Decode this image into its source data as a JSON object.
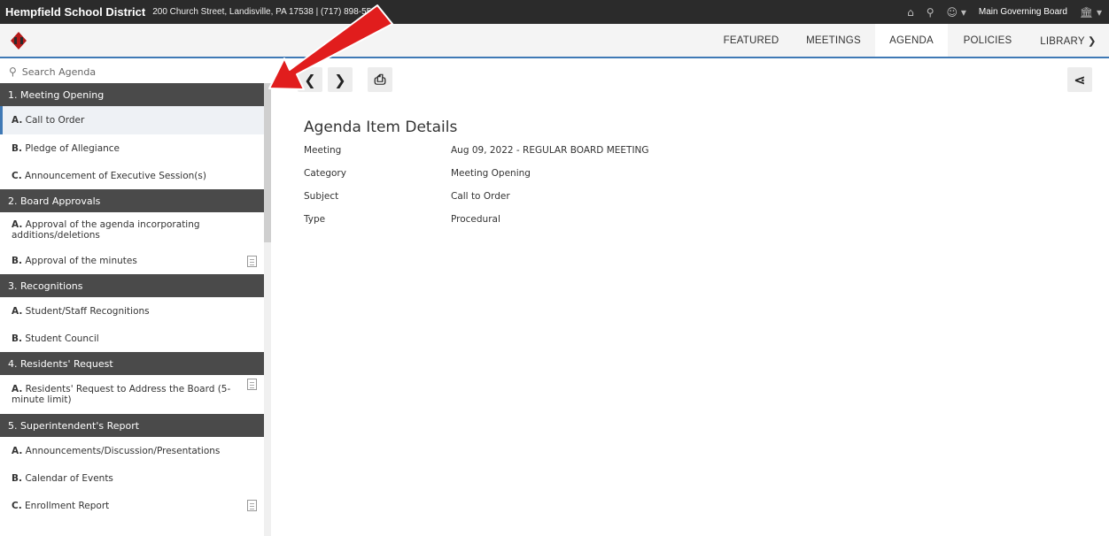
{
  "topbar": {
    "district": "Hempfield School District",
    "address": "200 Church Street, Landisville, PA 17538 | (717) 898-5564",
    "board": "Main Governing Board"
  },
  "icons": {
    "home": "home-icon",
    "search": "search-icon",
    "user": "user-icon",
    "building": "building-icon"
  },
  "nav": {
    "items": [
      {
        "label": "FEATURED"
      },
      {
        "label": "MEETINGS"
      },
      {
        "label": "AGENDA"
      },
      {
        "label": "POLICIES"
      },
      {
        "label": "LIBRARY ❯"
      }
    ],
    "active": "AGENDA"
  },
  "sidebar": {
    "search_placeholder": "Search Agenda",
    "sections": [
      {
        "title": "1. Meeting Opening",
        "items": [
          {
            "letter": "A.",
            "text": "Call to Order",
            "selected": true
          },
          {
            "letter": "B.",
            "text": "Pledge of Allegiance"
          },
          {
            "letter": "C.",
            "text": "Announcement of Executive Session(s)"
          }
        ]
      },
      {
        "title": "2. Board Approvals",
        "items": [
          {
            "letter": "A.",
            "text": "Approval of the agenda incorporating additions/deletions"
          },
          {
            "letter": "B.",
            "text": "Approval of the minutes",
            "doc": true
          }
        ]
      },
      {
        "title": "3. Recognitions",
        "items": [
          {
            "letter": "A.",
            "text": "Student/Staff Recognitions"
          },
          {
            "letter": "B.",
            "text": "Student Council"
          }
        ]
      },
      {
        "title": "4. Residents' Request",
        "items": [
          {
            "letter": "A.",
            "text": "Residents' Request to Address the Board (5-minute limit)",
            "doc": true
          }
        ]
      },
      {
        "title": "5. Superintendent's Report",
        "items": [
          {
            "letter": "A.",
            "text": "Announcements/Discussion/Presentations"
          },
          {
            "letter": "B.",
            "text": "Calendar of Events"
          },
          {
            "letter": "C.",
            "text": "Enrollment Report",
            "doc": true
          }
        ]
      }
    ]
  },
  "main": {
    "title": "Agenda Item Details",
    "details": [
      {
        "label": "Meeting",
        "value": "Aug 09, 2022 - REGULAR BOARD MEETING"
      },
      {
        "label": "Category",
        "value": "Meeting Opening"
      },
      {
        "label": "Subject",
        "value": "Call to Order"
      },
      {
        "label": "Type",
        "value": "Procedural"
      }
    ]
  },
  "colors": {
    "accent": "#3f79b5",
    "section_bg": "#4a4a4a",
    "topbar_bg": "#2b2b2b",
    "annotation_arrow": "#e11d1d"
  }
}
